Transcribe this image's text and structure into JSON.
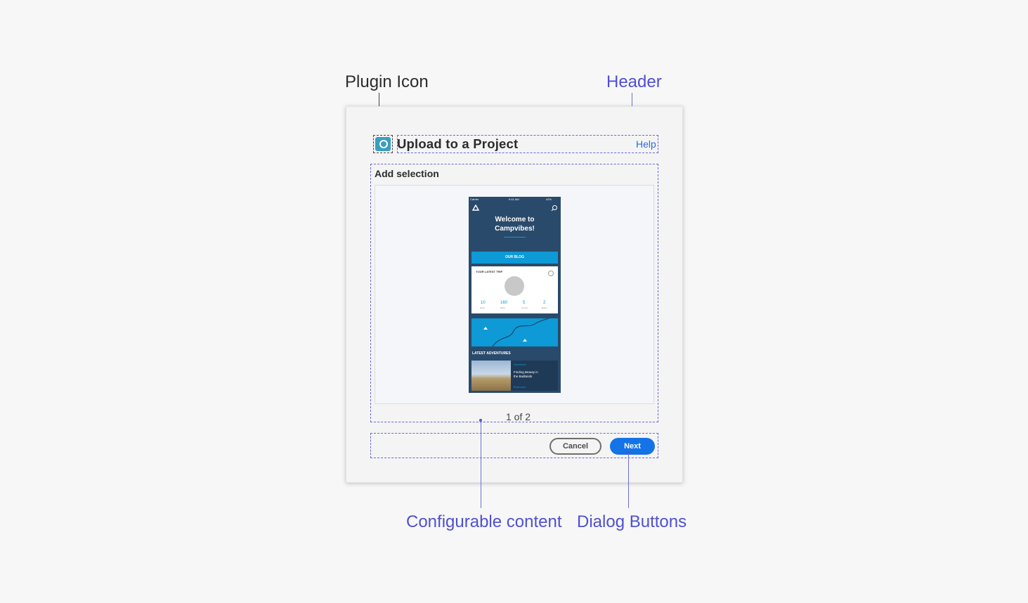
{
  "callouts": {
    "plugin_icon": "Plugin Icon",
    "header": "Header",
    "configurable_content": "Configurable content",
    "dialog_buttons": "Dialog Buttons"
  },
  "dialog": {
    "title": "Upload to a Project",
    "help": "Help",
    "section_label": "Add selection",
    "pager": "1 of 2",
    "cancel": "Cancel",
    "next": "Next"
  },
  "phone": {
    "status_carrier": "Carrier",
    "status_time": "9:41 AM",
    "status_battery": "42%",
    "welcome_line1": "Welcome to",
    "welcome_line2": "Campvibes!",
    "blog_button": "OUR BLOG",
    "latest_trip": "YOUR LATEST TRIP",
    "stats": [
      {
        "value": "10",
        "label": "Days"
      },
      {
        "value": "160",
        "label": "Miles"
      },
      {
        "value": "5",
        "label": "Camps"
      },
      {
        "value": "2",
        "label": "Bears"
      }
    ],
    "latest_adventures": "LATEST ADVENTURES",
    "adventure_category": "Adventures",
    "adventure_title_1": "Finding Beauty in",
    "adventure_title_2": "the Badlands",
    "adventure_link": "Read more"
  },
  "colors": {
    "accent_blue": "#1473e6",
    "annotation_blue": "#5050d0",
    "phone_bg": "#2a4a6b",
    "phone_accent": "#0d9ad6"
  }
}
